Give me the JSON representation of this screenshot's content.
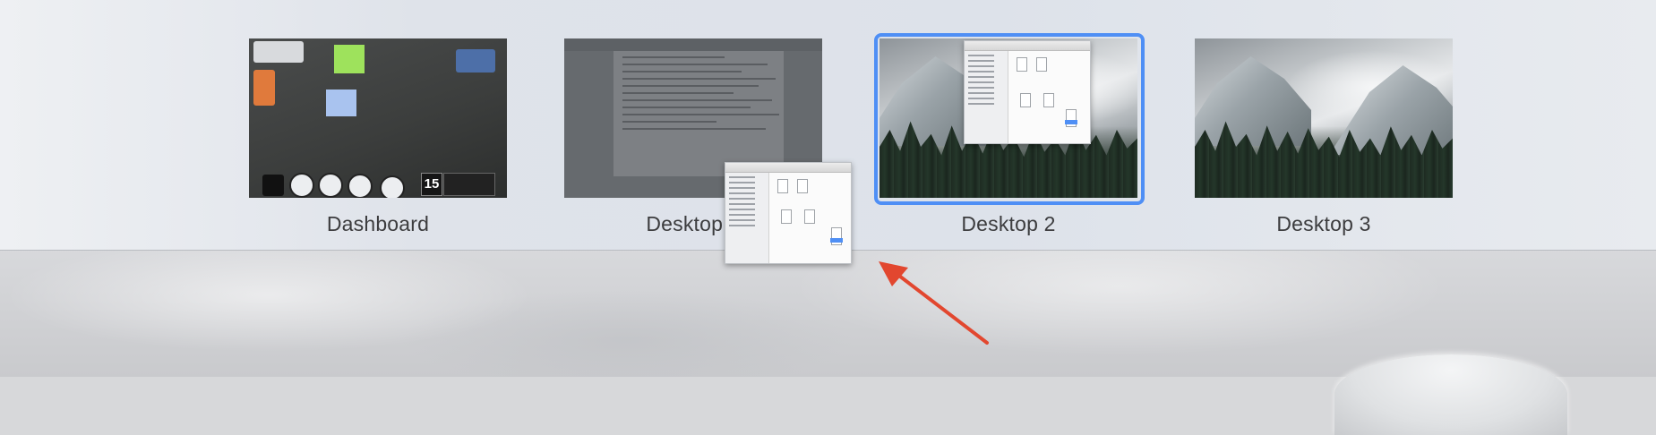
{
  "spaces": [
    {
      "label": "Dashboard",
      "selected": false
    },
    {
      "label": "Desktop 1",
      "selected": false
    },
    {
      "label": "Desktop 2",
      "selected": true
    },
    {
      "label": "Desktop 3",
      "selected": false
    }
  ],
  "dashboard_widgets": {
    "calendar_date": "15"
  },
  "colors": {
    "selection_ring": "#4f8ff5",
    "annotation_arrow": "#e2472f"
  },
  "icons": [
    "finder-window-thumbnail",
    "annotation-arrow"
  ]
}
